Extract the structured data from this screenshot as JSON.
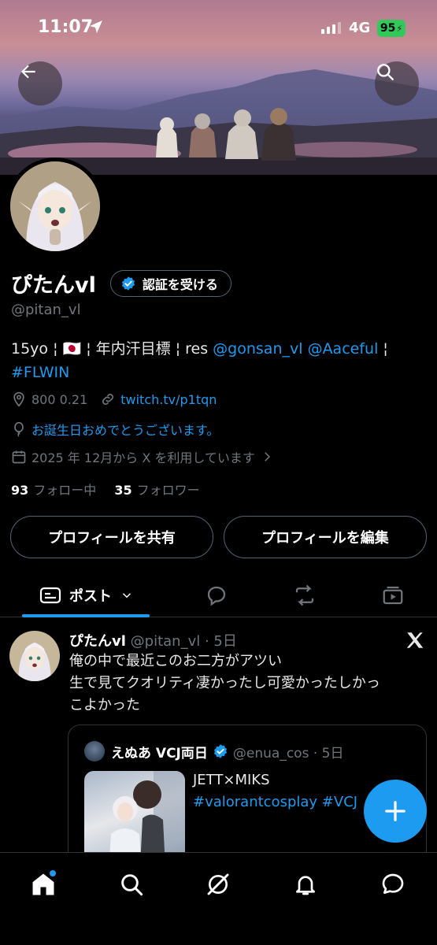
{
  "status_bar": {
    "time": "11:07",
    "network": "4G",
    "battery": "95"
  },
  "profile": {
    "display_name": "ぴたんvl",
    "verify_label": "認証を受ける",
    "handle": "@pitan_vl",
    "bio": {
      "prefix": "15yo ¦ 🇯🇵 ¦ 年内汗目標 ¦ res ",
      "mention1": "@gonsan_vl",
      "mention2": "@Aaceful",
      "separator": " ¦",
      "hashtag": "#FLWIN"
    },
    "location": "800 0.21",
    "website": "twitch.tv/p1tqn",
    "birthday": "お誕生日おめでとうございます。",
    "joined": "2025 年 12月から X を利用しています",
    "following_count": "93",
    "following_label": "フォロー中",
    "followers_count": "35",
    "followers_label": "フォロワー"
  },
  "buttons": {
    "share": "プロフィールを共有",
    "edit": "プロフィールを編集"
  },
  "tabs": {
    "posts": "ポスト"
  },
  "post": {
    "author": "ぴたんvl",
    "meta": "@pitan_vl · 5日",
    "line1": "俺の中で最近このお二方がアツい",
    "line2": "生で見てクオリティ凄かったし可愛かったしかっ",
    "line3": "こよかった",
    "quote": {
      "author": "えぬあ VCJ両日",
      "meta": "@enua_cos · 5日",
      "line1": "JETT×MIKS",
      "line2": "#valorantcosplay #VCJ"
    }
  },
  "colors": {
    "accent": "#1d9bf0",
    "verify_badge": "#1d9bf0",
    "battery": "#34c759"
  }
}
